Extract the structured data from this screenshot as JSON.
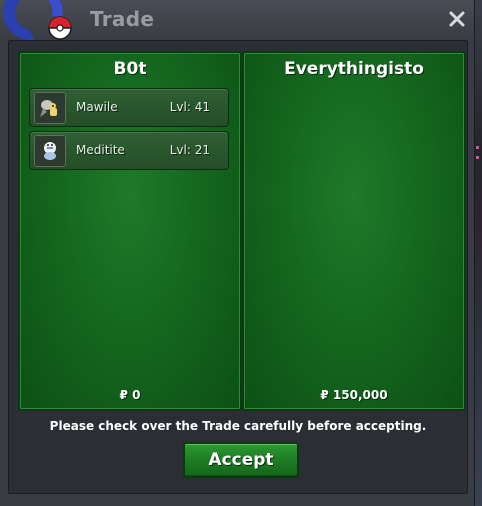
{
  "window": {
    "title": "Trade",
    "close_icon": "close-icon"
  },
  "left_panel": {
    "player_name": "B0t",
    "items": [
      {
        "name": "Mawile",
        "level": "Lvl: 41",
        "icon": "mawile-sprite-icon"
      },
      {
        "name": "Meditite",
        "level": "Lvl: 21",
        "icon": "meditite-sprite-icon"
      }
    ],
    "money": "₽ 0"
  },
  "right_panel": {
    "player_name": "Everythingisto",
    "items": [],
    "money": "₽ 150,000"
  },
  "footer": {
    "message": "Please check over the Trade carefully before accepting.",
    "accept_label": "Accept"
  },
  "colors": {
    "panel_green": "#13631d",
    "accept_green": "#1d7d24",
    "window_bg": "#3a3c44"
  }
}
